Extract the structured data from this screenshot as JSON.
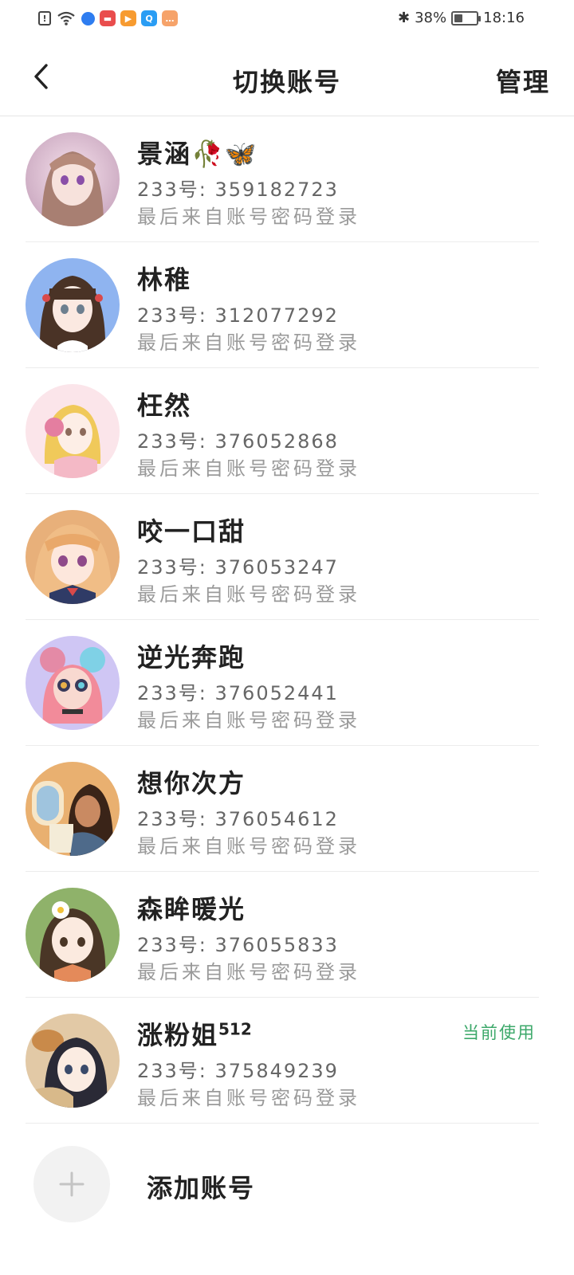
{
  "status_bar": {
    "battery_percent": "38%",
    "battery_level": 0.38,
    "time": "18:16",
    "icons": [
      "alert-icon",
      "wifi-icon",
      "globe-icon",
      "red-app-icon",
      "play-app-icon",
      "search-app-icon",
      "chat-app-icon",
      "bluetooth-icon",
      "battery-icon"
    ]
  },
  "header": {
    "back_icon": "chevron-left-icon",
    "title": "切换账号",
    "manage_label": "管理"
  },
  "accounts": [
    {
      "name": "景涵🥀🦋",
      "id_line": "233号: 359182723",
      "source": "最后来自账号密码登录",
      "current": ""
    },
    {
      "name": "林稚",
      "id_line": "233号: 312077292",
      "source": "最后来自账号密码登录",
      "current": ""
    },
    {
      "name": "枉然",
      "id_line": "233号: 376052868",
      "source": "最后来自账号密码登录",
      "current": ""
    },
    {
      "name": "咬一口甜",
      "id_line": "233号: 376053247",
      "source": "最后来自账号密码登录",
      "current": ""
    },
    {
      "name": "逆光奔跑",
      "id_line": "233号: 376052441",
      "source": "最后来自账号密码登录",
      "current": ""
    },
    {
      "name": "想你次方",
      "id_line": "233号: 376054612",
      "source": "最后来自账号密码登录",
      "current": ""
    },
    {
      "name": "森眸暖光",
      "id_line": "233号: 376055833",
      "source": "最后来自账号密码登录",
      "current": ""
    },
    {
      "name": "涨粉姐",
      "name_suffix": "512",
      "id_line": "233号: 375849239",
      "source": "最后来自账号密码登录",
      "current": "当前使用"
    }
  ],
  "add_account": {
    "icon": "plus-icon",
    "label": "添加账号"
  },
  "colors": {
    "accent_green": "#3ca86a",
    "divider": "#ececec",
    "secondary_text": "#9a9a9a"
  }
}
